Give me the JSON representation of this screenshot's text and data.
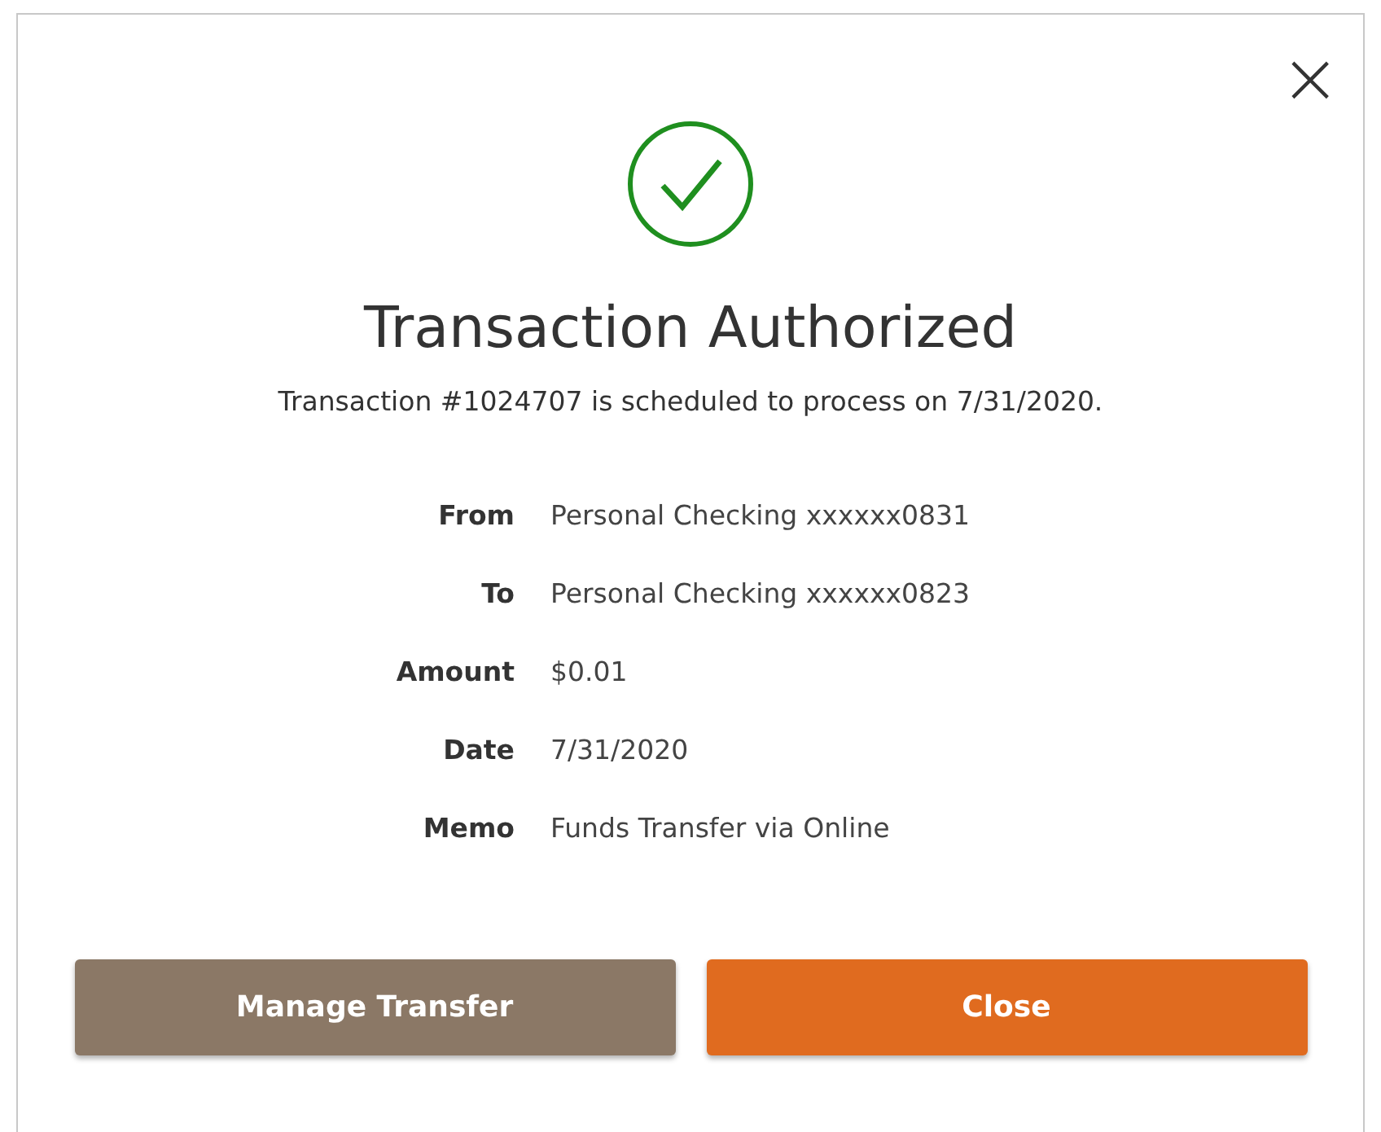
{
  "dialog": {
    "close_glyph": "×",
    "title": "Transaction Authorized",
    "message": "Transaction #1024707 is scheduled to process on 7/31/2020.",
    "details": [
      {
        "label": "From",
        "value": "Personal Checking xxxxxx0831"
      },
      {
        "label": "To",
        "value": "Personal Checking xxxxxx0823"
      },
      {
        "label": "Amount",
        "value": "$0.01"
      },
      {
        "label": "Date",
        "value": "7/31/2020"
      },
      {
        "label": "Memo",
        "value": "Funds Transfer via Online"
      }
    ],
    "buttons": [
      {
        "label": "Manage Transfer",
        "kind": "secondary"
      },
      {
        "label": "Close",
        "kind": "primary"
      }
    ]
  }
}
